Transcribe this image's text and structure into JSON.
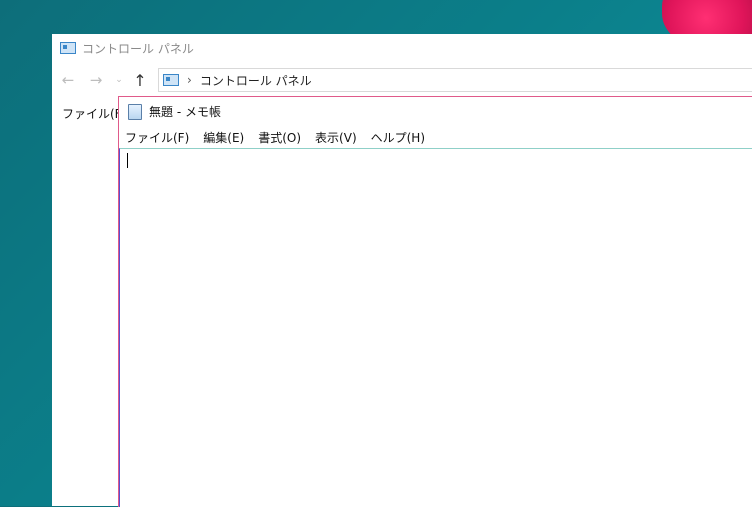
{
  "control_panel": {
    "title": "コントロール パネル",
    "nav": {
      "back_glyph": "←",
      "forward_glyph": "→",
      "recent_glyph": "⌄",
      "up_glyph": "↑"
    },
    "address": {
      "separator": "›",
      "path": "コントロール パネル"
    },
    "menu": {
      "file": "ファイル(F)"
    }
  },
  "notepad": {
    "title": "無題 - メモ帳",
    "menu": [
      {
        "label": "ファイル(F)"
      },
      {
        "label": "編集(E)"
      },
      {
        "label": "書式(O)"
      },
      {
        "label": "表示(V)"
      },
      {
        "label": "ヘルプ(H)"
      }
    ],
    "content": ""
  }
}
